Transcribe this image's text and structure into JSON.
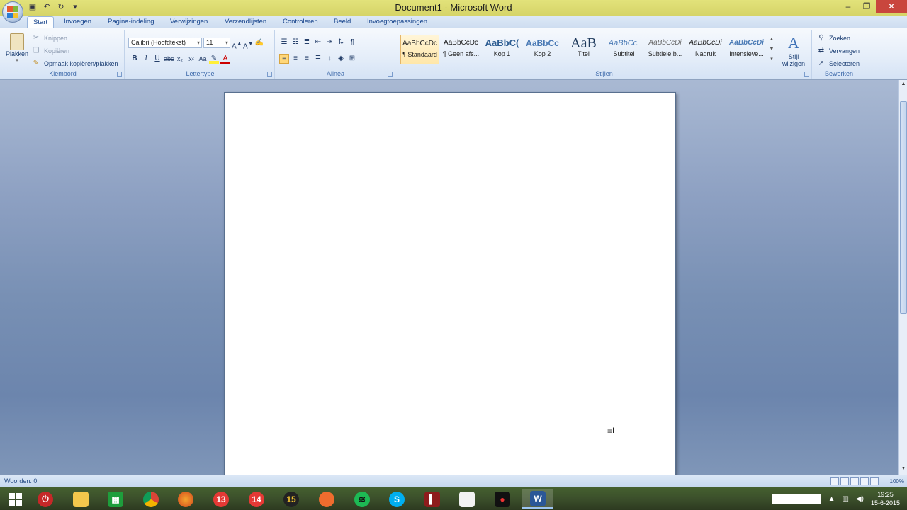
{
  "window": {
    "title": "Document1 - Microsoft Word"
  },
  "tabs": [
    "Start",
    "Invoegen",
    "Pagina-indeling",
    "Verwijzingen",
    "Verzendlijsten",
    "Controleren",
    "Beeld",
    "Invoegtoepassingen"
  ],
  "clipboard": {
    "paste": "Plakken",
    "cut": "Knippen",
    "copy": "Kopiëren",
    "format_painter": "Opmaak kopiëren/plakken",
    "label": "Klembord"
  },
  "font": {
    "name": "Calibri (Hoofdtekst)",
    "size": "11",
    "label": "Lettertype"
  },
  "paragraph": {
    "label": "Alinea"
  },
  "styles": {
    "label": "Stijlen",
    "items": [
      {
        "sample": "AaBbCcDc",
        "name": "¶ Standaard"
      },
      {
        "sample": "AaBbCcDc",
        "name": "¶ Geen afs..."
      },
      {
        "sample": "AaBbC(",
        "name": "Kop 1"
      },
      {
        "sample": "AaBbCc",
        "name": "Kop 2"
      },
      {
        "sample": "AaB",
        "name": "Titel"
      },
      {
        "sample": "AaBbCc.",
        "name": "Subtitel"
      },
      {
        "sample": "AaBbCcDi",
        "name": "Subtiele b..."
      },
      {
        "sample": "AaBbCcDi",
        "name": "Nadruk"
      },
      {
        "sample": "AaBbCcDi",
        "name": "Intensieve..."
      }
    ],
    "change_label": "Stijl wijzigen"
  },
  "editing": {
    "find": "Zoeken",
    "replace": "Vervangen",
    "select": "Selecteren",
    "label": "Bewerken"
  },
  "status": {
    "words": "Woorden: 0",
    "zoom": "100%"
  },
  "taskbar": {
    "time": "19:25",
    "date": "15-6-2015"
  },
  "colors": {
    "accent": "#15428b",
    "title_bar": "#dedb72",
    "close": "#c9463d"
  }
}
